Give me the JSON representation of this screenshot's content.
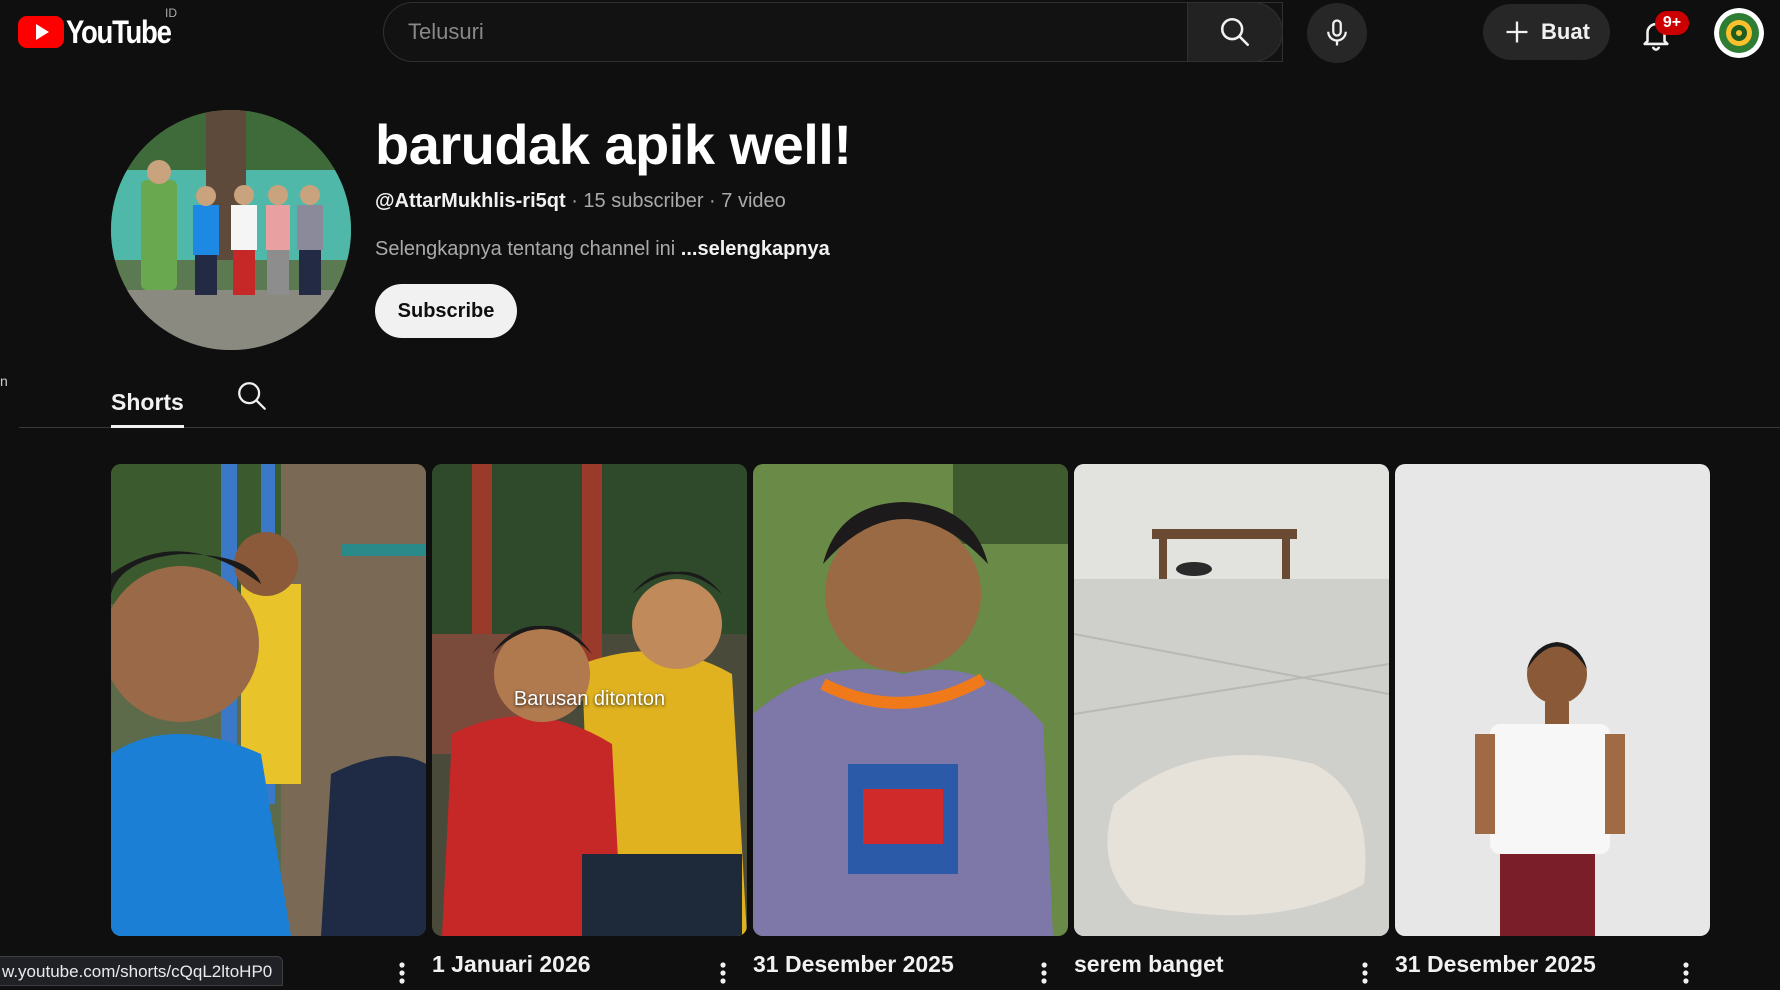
{
  "masthead": {
    "logo_text": "YouTube",
    "country_code": "ID",
    "search_placeholder": "Telusuri",
    "create_label": "Buat",
    "notification_count": "9+",
    "icons": [
      "menu-icon",
      "search-icon",
      "mic-icon",
      "plus-icon",
      "bell-icon",
      "avatar"
    ]
  },
  "channel": {
    "name": "barudak apik well!",
    "handle": "@AttarMukhlis-ri5qt",
    "subscribers": "15 subscriber",
    "videos": "7 video",
    "separator": "·",
    "about": "Selengkapnya tentang channel ini",
    "about_more": "...selengkapnya",
    "subscribe_label": "Subscribe"
  },
  "edge_text": "n",
  "tabs": {
    "active": "Shorts"
  },
  "shorts": [
    {
      "title": "",
      "watched": ""
    },
    {
      "title": "1 Januari 2026",
      "watched": "Barusan ditonton"
    },
    {
      "title": "31 Desember 2025",
      "watched": ""
    },
    {
      "title": "serem banget",
      "watched": ""
    },
    {
      "title": "31 Desember 2025",
      "watched": ""
    }
  ],
  "status_bar": {
    "url": "w.youtube.com/shorts/cQqL2ltoHP0"
  },
  "colors": {
    "background": "#0f0f0f",
    "brand_red": "#ff0000",
    "badge_red": "#cc0000",
    "text_primary": "#f1f1f1",
    "text_secondary": "#aaaaaa"
  }
}
